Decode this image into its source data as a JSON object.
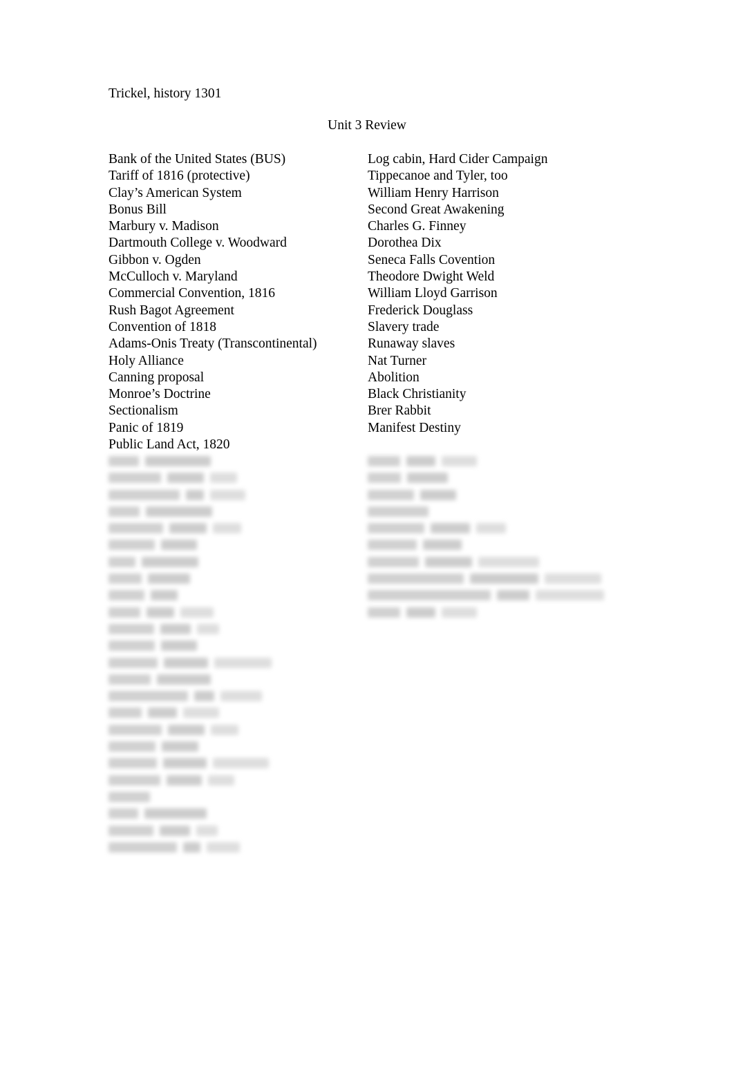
{
  "document": {
    "header": "Trickel, history 1301",
    "title": "Unit 3 Review"
  },
  "terms": {
    "left_column": [
      "Bank of the United States (BUS)",
      "Tariff of 1816 (protective)",
      "Clay’s American System",
      "Bonus Bill",
      "Marbury v. Madison",
      "Dartmouth College v. Woodward",
      "Gibbon v. Ogden",
      "McCulloch v. Maryland",
      "Commercial Convention, 1816",
      "Rush Bagot Agreement",
      "Convention of 1818",
      "Adams-Onis Treaty (Transcontinental)",
      "Holy Alliance",
      "Canning proposal",
      "Monroe’s Doctrine",
      "Sectionalism",
      "Panic of 1819",
      "Public Land Act, 1820"
    ],
    "right_column": [
      "Log cabin, Hard Cider Campaign",
      "Tippecanoe and Tyler, too",
      "William Henry Harrison",
      "Second Great Awakening",
      "Charles G. Finney",
      "Dorothea Dix",
      "Seneca Falls Covention",
      "Theodore Dwight Weld",
      "William Lloyd Garrison",
      "Frederick Douglass",
      "Slavery trade",
      "Runaway slaves",
      "Nat Turner",
      "Abolition",
      "Black Christianity",
      "Brer Rabbit",
      "Manifest Destiny"
    ]
  },
  "obscured": {
    "note": "Text below this point is blurred and illegible in the source image.",
    "left_column_line_widths": [
      148,
      186,
      198,
      150,
      192,
      128,
      130,
      118,
      100,
      152,
      160,
      128,
      236,
      148,
      222,
      160,
      188,
      130,
      232,
      182,
      60,
      142,
      158,
      190
    ],
    "right_column_line_widths": [
      158,
      116,
      128,
      88,
      200,
      136,
      248,
      338,
      342,
      158
    ]
  }
}
